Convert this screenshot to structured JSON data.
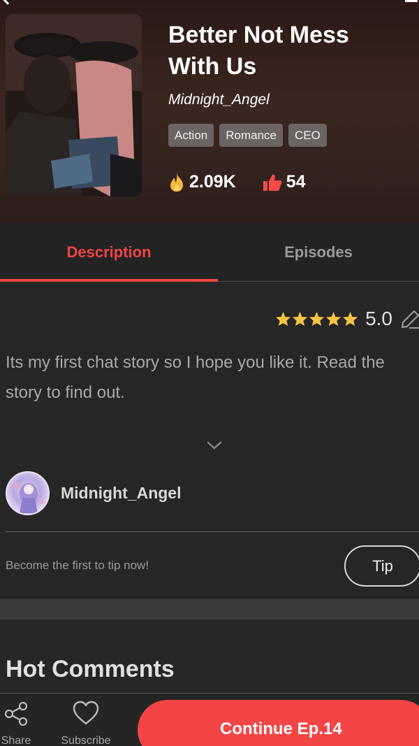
{
  "book": {
    "title": "Better Not Mess With Us",
    "author": "Midnight_Angel",
    "tags": [
      "Action",
      "Romance",
      "CEO"
    ],
    "views": "2.09K",
    "likes": "54"
  },
  "tabs": {
    "description": "Description",
    "episodes": "Episodes"
  },
  "rating": {
    "stars": 5,
    "value": "5.0"
  },
  "description": {
    "text": "Its my first chat story so I hope you like it. Read the story to find out."
  },
  "author_card": {
    "name": "Midnight_Angel"
  },
  "tip": {
    "prompt": "Become the first to tip now!",
    "button": "Tip"
  },
  "comments": {
    "heading": "Hot Comments"
  },
  "bottom_bar": {
    "share": "Share",
    "subscribe": "Subscribe",
    "continue": "Continue Ep.14"
  },
  "colors": {
    "accent": "#f24444",
    "background": "#262626",
    "star": "#f6c545"
  }
}
